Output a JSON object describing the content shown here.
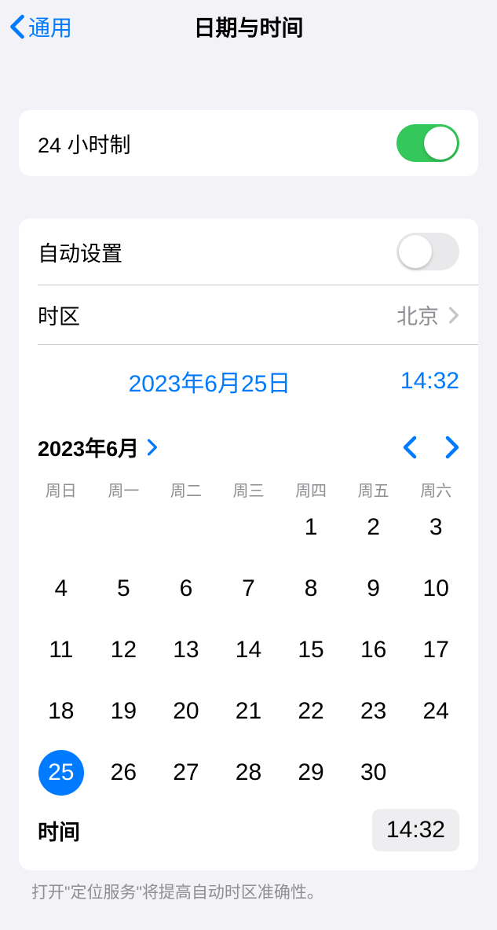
{
  "header": {
    "back_label": "通用",
    "title": "日期与时间"
  },
  "section1": {
    "clock24_label": "24 小时制",
    "clock24_on": true
  },
  "section2": {
    "auto_label": "自动设置",
    "auto_on": false,
    "timezone_label": "时区",
    "timezone_value": "北京",
    "date_display": "2023年6月25日",
    "time_display": "14:32",
    "month_label": "2023年6月",
    "weekdays": [
      "周日",
      "周一",
      "周二",
      "周三",
      "周四",
      "周五",
      "周六"
    ],
    "offset": 4,
    "days": [
      "1",
      "2",
      "3",
      "4",
      "5",
      "6",
      "7",
      "8",
      "9",
      "10",
      "11",
      "12",
      "13",
      "14",
      "15",
      "16",
      "17",
      "18",
      "19",
      "20",
      "21",
      "22",
      "23",
      "24",
      "25",
      "26",
      "27",
      "28",
      "29",
      "30"
    ],
    "selected_day": "25",
    "time_row_label": "时间",
    "time_row_value": "14:32"
  },
  "footer": {
    "text": "打开\"定位服务\"将提高自动时区准确性。"
  }
}
